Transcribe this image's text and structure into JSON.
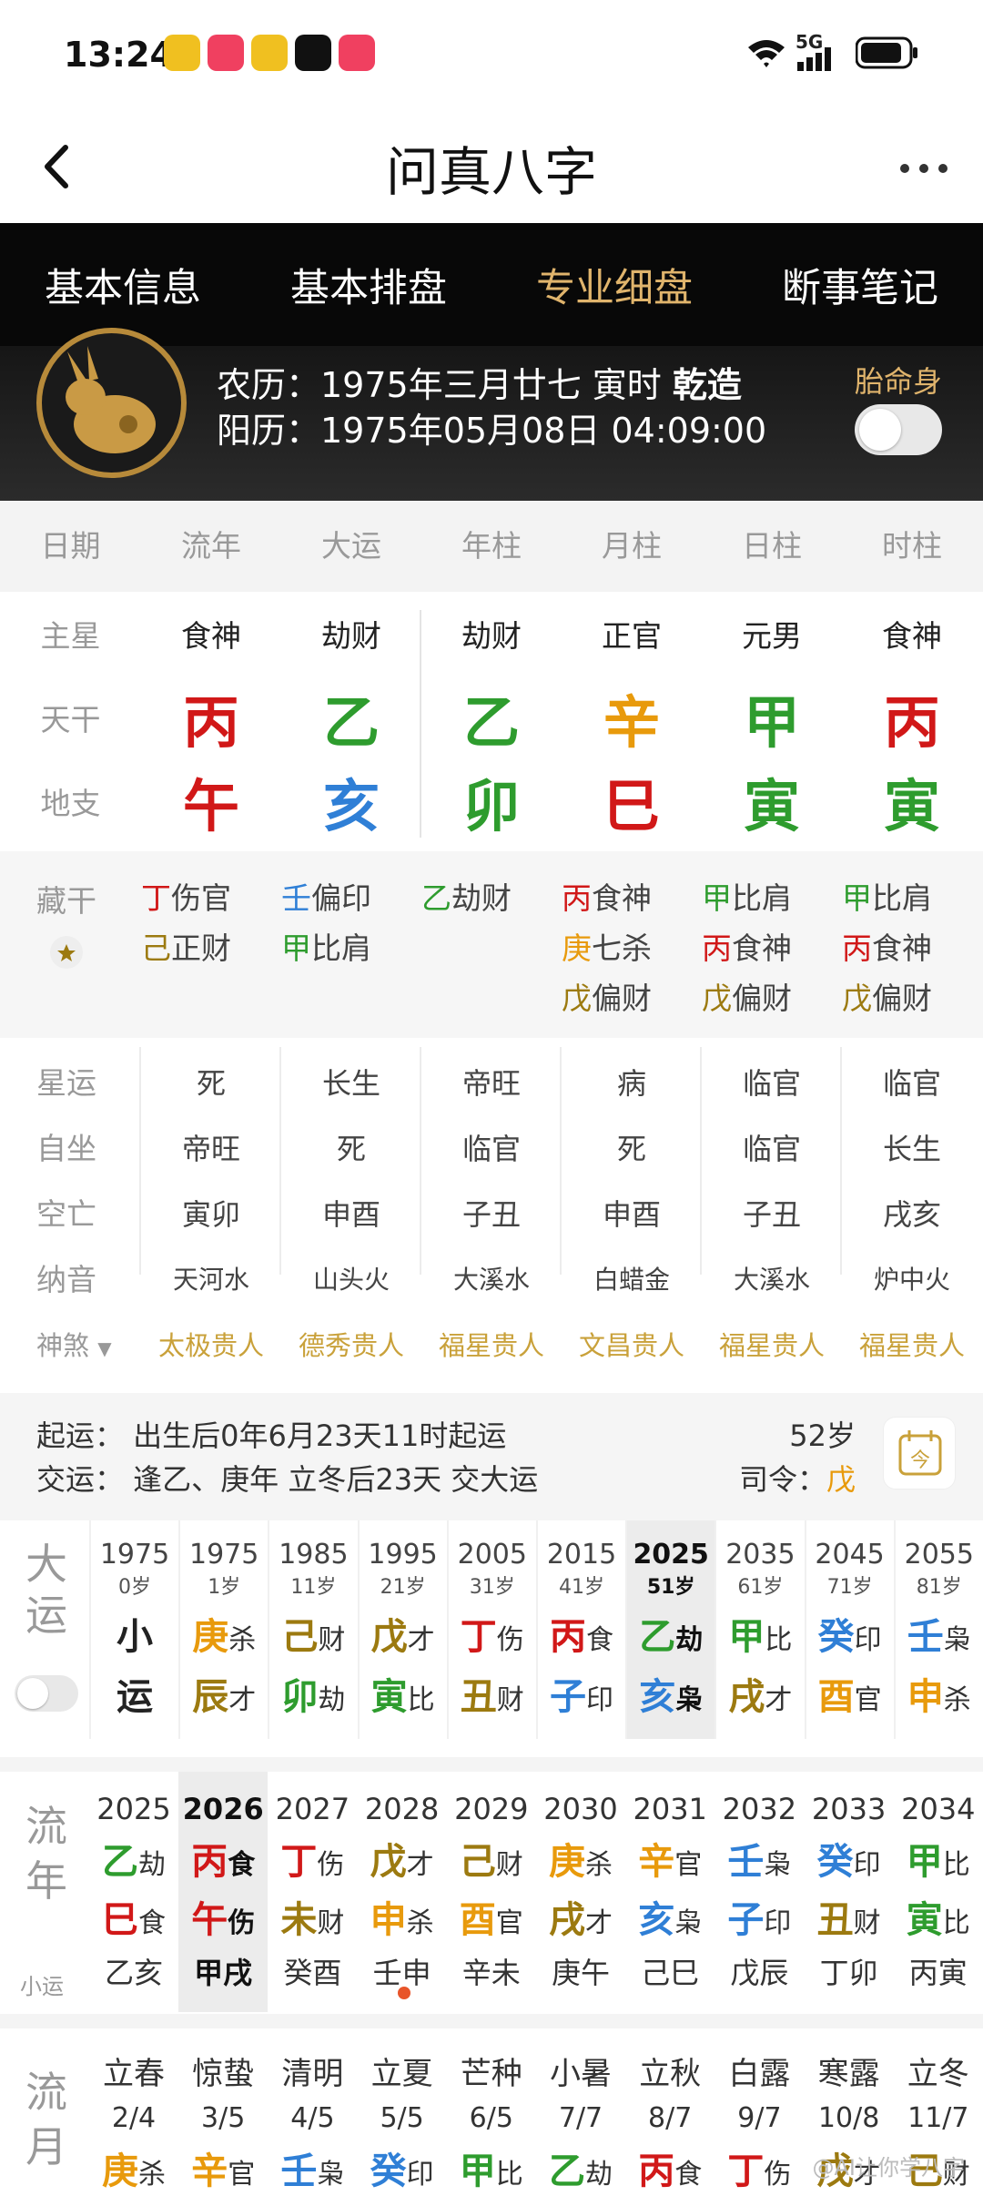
{
  "status": {
    "time": "13:24",
    "network": "5G"
  },
  "title": "问真八字",
  "tabs": [
    "基本信息",
    "基本排盘",
    "专业细盘",
    "断事笔记"
  ],
  "header": {
    "lunar": "农历：1975年三月廿七 寅时",
    "gender": "乾造",
    "solar": "阳历：1975年05月08日 04:09:00",
    "taimingshen": "胎命身"
  },
  "columns": [
    "日期",
    "流年",
    "大运",
    "年柱",
    "月柱",
    "日柱",
    "时柱"
  ],
  "rows": {
    "zhuxing": {
      "label": "主星",
      "values": [
        "食神",
        "劫财",
        "劫财",
        "正官",
        "元男",
        "食神"
      ]
    },
    "tiangan": {
      "label": "天干",
      "values": [
        "丙",
        "乙",
        "乙",
        "辛",
        "甲",
        "丙"
      ]
    },
    "dizhi": {
      "label": "地支",
      "values": [
        "午",
        "亥",
        "卯",
        "巳",
        "寅",
        "寅"
      ]
    }
  },
  "canggan": {
    "label": "藏干",
    "cols": [
      [
        [
          "丁",
          "伤官"
        ],
        [
          "己",
          "正财"
        ]
      ],
      [
        [
          "壬",
          "偏印"
        ],
        [
          "甲",
          "比肩"
        ]
      ],
      [
        [
          "乙",
          "劫财"
        ]
      ],
      [
        [
          "丙",
          "食神"
        ],
        [
          "庚",
          "七杀"
        ],
        [
          "戊",
          "偏财"
        ]
      ],
      [
        [
          "甲",
          "比肩"
        ],
        [
          "丙",
          "食神"
        ],
        [
          "戊",
          "偏财"
        ]
      ],
      [
        [
          "甲",
          "比肩"
        ],
        [
          "丙",
          "食神"
        ],
        [
          "戊",
          "偏财"
        ]
      ]
    ]
  },
  "xingyun": {
    "label": "星运",
    "values": [
      "死",
      "长生",
      "帝旺",
      "病",
      "临官",
      "临官"
    ]
  },
  "zizuo": {
    "label": "自坐",
    "values": [
      "帝旺",
      "死",
      "临官",
      "死",
      "临官",
      "长生"
    ]
  },
  "kongwang": {
    "label": "空亡",
    "values": [
      "寅卯",
      "申酉",
      "子丑",
      "申酉",
      "子丑",
      "戌亥"
    ]
  },
  "nayin": {
    "label": "纳音",
    "values": [
      "天河水",
      "山头火",
      "大溪水",
      "白蜡金",
      "大溪水",
      "炉中火"
    ]
  },
  "shensha": {
    "label": "神煞",
    "values": [
      "太极贵人",
      "德秀贵人",
      "福星贵人",
      "文昌贵人",
      "福星贵人",
      "福星贵人"
    ]
  },
  "qiyun": {
    "line1": "起运：  出生后0年6月23天11时起运",
    "line2": "交运：  逢乙、庚年 立冬后23天 交大运",
    "age": "52岁",
    "siling_label": "司令：",
    "siling": "戊"
  },
  "dayun": {
    "label": "大运",
    "cols": [
      {
        "yr": "1975",
        "ag": "0岁",
        "g": "小",
        "gs": "",
        "z": "运",
        "zs": ""
      },
      {
        "yr": "1975",
        "ag": "1岁",
        "g": "庚",
        "gs": "杀",
        "z": "辰",
        "zs": "才"
      },
      {
        "yr": "1985",
        "ag": "11岁",
        "g": "己",
        "gs": "财",
        "z": "卯",
        "zs": "劫"
      },
      {
        "yr": "1995",
        "ag": "21岁",
        "g": "戊",
        "gs": "才",
        "z": "寅",
        "zs": "比"
      },
      {
        "yr": "2005",
        "ag": "31岁",
        "g": "丁",
        "gs": "伤",
        "z": "丑",
        "zs": "财"
      },
      {
        "yr": "2015",
        "ag": "41岁",
        "g": "丙",
        "gs": "食",
        "z": "子",
        "zs": "印"
      },
      {
        "yr": "2025",
        "ag": "51岁",
        "g": "乙",
        "gs": "劫",
        "z": "亥",
        "zs": "枭"
      },
      {
        "yr": "2035",
        "ag": "61岁",
        "g": "甲",
        "gs": "比",
        "z": "戌",
        "zs": "才"
      },
      {
        "yr": "2045",
        "ag": "71岁",
        "g": "癸",
        "gs": "印",
        "z": "酉",
        "zs": "官"
      },
      {
        "yr": "2055",
        "ag": "81岁",
        "g": "壬",
        "gs": "枭",
        "z": "申",
        "zs": "杀"
      }
    ]
  },
  "liunian": {
    "label": "流年",
    "sublabel": "小运",
    "cols": [
      {
        "yr": "2025",
        "g": "乙",
        "gs": "劫",
        "z": "巳",
        "zs": "食",
        "xy": "乙亥"
      },
      {
        "yr": "2026",
        "g": "丙",
        "gs": "食",
        "z": "午",
        "zs": "伤",
        "xy": "甲戌"
      },
      {
        "yr": "2027",
        "g": "丁",
        "gs": "伤",
        "z": "未",
        "zs": "财",
        "xy": "癸酉"
      },
      {
        "yr": "2028",
        "g": "戊",
        "gs": "才",
        "z": "申",
        "zs": "杀",
        "xy": "壬申"
      },
      {
        "yr": "2029",
        "g": "己",
        "gs": "财",
        "z": "酉",
        "zs": "官",
        "xy": "辛未"
      },
      {
        "yr": "2030",
        "g": "庚",
        "gs": "杀",
        "z": "戌",
        "zs": "才",
        "xy": "庚午"
      },
      {
        "yr": "2031",
        "g": "辛",
        "gs": "官",
        "z": "亥",
        "zs": "枭",
        "xy": "己巳"
      },
      {
        "yr": "2032",
        "g": "壬",
        "gs": "枭",
        "z": "子",
        "zs": "印",
        "xy": "戊辰"
      },
      {
        "yr": "2033",
        "g": "癸",
        "gs": "印",
        "z": "丑",
        "zs": "财",
        "xy": "丁卯"
      },
      {
        "yr": "2034",
        "g": "甲",
        "gs": "比",
        "z": "寅",
        "zs": "比",
        "xy": "丙寅"
      }
    ]
  },
  "liuyue": {
    "label": "流月",
    "cols": [
      {
        "jq": "立春",
        "dt": "2/4",
        "g": "庚",
        "gs": "杀"
      },
      {
        "jq": "惊蛰",
        "dt": "3/5",
        "g": "辛",
        "gs": "官"
      },
      {
        "jq": "清明",
        "dt": "4/5",
        "g": "壬",
        "gs": "枭"
      },
      {
        "jq": "立夏",
        "dt": "5/5",
        "g": "癸",
        "gs": "印"
      },
      {
        "jq": "芒种",
        "dt": "6/5",
        "g": "甲",
        "gs": "比"
      },
      {
        "jq": "小暑",
        "dt": "7/7",
        "g": "乙",
        "gs": "劫"
      },
      {
        "jq": "立秋",
        "dt": "8/7",
        "g": "丙",
        "gs": "食"
      },
      {
        "jq": "白露",
        "dt": "9/7",
        "g": "丁",
        "gs": "伤"
      },
      {
        "jq": "寒露",
        "dt": "10/8",
        "g": "戊",
        "gs": "才"
      },
      {
        "jq": "立冬",
        "dt": "11/7",
        "g": "己",
        "gs": "财"
      }
    ]
  },
  "watermark": "@AI让你学八字"
}
